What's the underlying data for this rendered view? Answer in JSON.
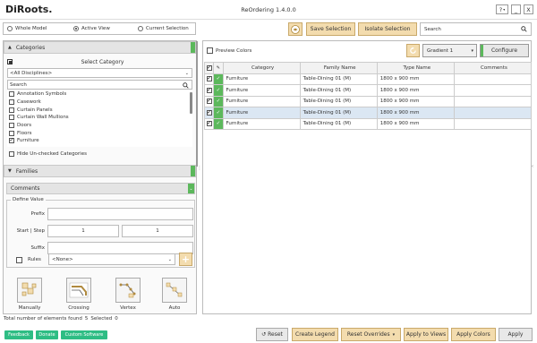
{
  "window": {
    "logo": "DiRoots.",
    "title": "ReOrdering 1.4.0.0",
    "help": "?",
    "min_btn": "_",
    "close_btn": "X",
    "help_arrow": "▾"
  },
  "scope": {
    "options": [
      "Whole Model",
      "Active View",
      "Current Selection"
    ],
    "selected": "Active View"
  },
  "toolbar": {
    "save_selection": "Save Selection",
    "isolate_selection": "Isolate Selection",
    "search_placeholder": "Search"
  },
  "categories": {
    "header": "Categories",
    "select_label": "Select Category",
    "discipline": "<All Disciplines>",
    "search_placeholder": "Search",
    "items": [
      {
        "label": "Annotation Symbols",
        "checked": false
      },
      {
        "label": "Casework",
        "checked": false
      },
      {
        "label": "Curtain Panels",
        "checked": false
      },
      {
        "label": "Curtain Wall Mullions",
        "checked": false
      },
      {
        "label": "Doors",
        "checked": false
      },
      {
        "label": "Floors",
        "checked": false
      },
      {
        "label": "Furniture",
        "checked": true
      }
    ],
    "hide_unchecked": "Hide Un-checked Categories"
  },
  "families": {
    "header": "Families"
  },
  "parameter": {
    "selected": "Comments",
    "define_value": "Define Value",
    "prefix_label": "Prefix",
    "prefix_value": "",
    "start_step_label": "Start | Step",
    "start_value": "1",
    "step_value": "1",
    "suffix_label": "Suffix",
    "suffix_value": "",
    "rules_label": "Rules",
    "rules_value": "<None>",
    "add_btn": "+"
  },
  "connectors": [
    {
      "label": "Manually"
    },
    {
      "label": "Crossing"
    },
    {
      "label": "Vertex"
    },
    {
      "label": "Auto"
    }
  ],
  "preview": {
    "label": "Preview Colors",
    "gradient": "Gradient 1",
    "configure": "Configure"
  },
  "table": {
    "columns": [
      "Category",
      "Family Name",
      "Type Name",
      "Comments"
    ],
    "rows": [
      {
        "category": "Furniture",
        "family": "Table-Dining 01 (M)",
        "type": "1800 x 900 mm",
        "comments": "",
        "selected": false
      },
      {
        "category": "Furniture",
        "family": "Table-Dining 01 (M)",
        "type": "1800 x 900 mm",
        "comments": "",
        "selected": false
      },
      {
        "category": "Furniture",
        "family": "Table-Dining 01 (M)",
        "type": "1800 x 900 mm",
        "comments": "",
        "selected": false
      },
      {
        "category": "Furniture",
        "family": "Table-Dining 01 (M)",
        "type": "1800 x 900 mm",
        "comments": "",
        "selected": true
      },
      {
        "category": "Furniture",
        "family": "Table-Dining 01 (M)",
        "type": "1800 x 900 mm",
        "comments": "",
        "selected": false
      }
    ]
  },
  "status": {
    "total_label": "Total number of elements found",
    "total_value": "5",
    "selected_label": "Selected",
    "selected_value": "0"
  },
  "footer": {
    "feedback": "Feedback",
    "donate": "Donate",
    "custom_software": "Custom Software",
    "reset": "Reset",
    "create_legend": "Create Legend",
    "reset_overrides": "Reset Overrides",
    "apply_to_views": "Apply to Views",
    "apply_colors": "Apply Colors",
    "apply": "Apply"
  },
  "colors": {
    "accent_green": "#5cb85c",
    "beige": "#f3dcae",
    "footer_green": "#2ebd84"
  }
}
